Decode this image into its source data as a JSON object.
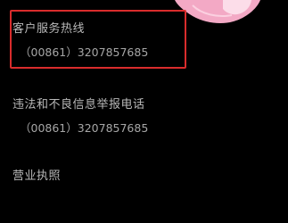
{
  "colors": {
    "background": "#000000",
    "label_text": "#b9b9b9",
    "phone_text": "#a6a6a6",
    "highlight_border": "#d92c2c",
    "decoration_pink": "#f3a9c5",
    "decoration_light": "#fde6ef"
  },
  "icons": {
    "top_decoration": "pink-wave-decoration-icon"
  },
  "rows": [
    {
      "label": "客户服务热线",
      "phone": "（00861）3207857685"
    },
    {
      "label": "违法和不良信息举报电话",
      "phone": "（00861）3207857685"
    },
    {
      "label": "营业执照"
    }
  ]
}
